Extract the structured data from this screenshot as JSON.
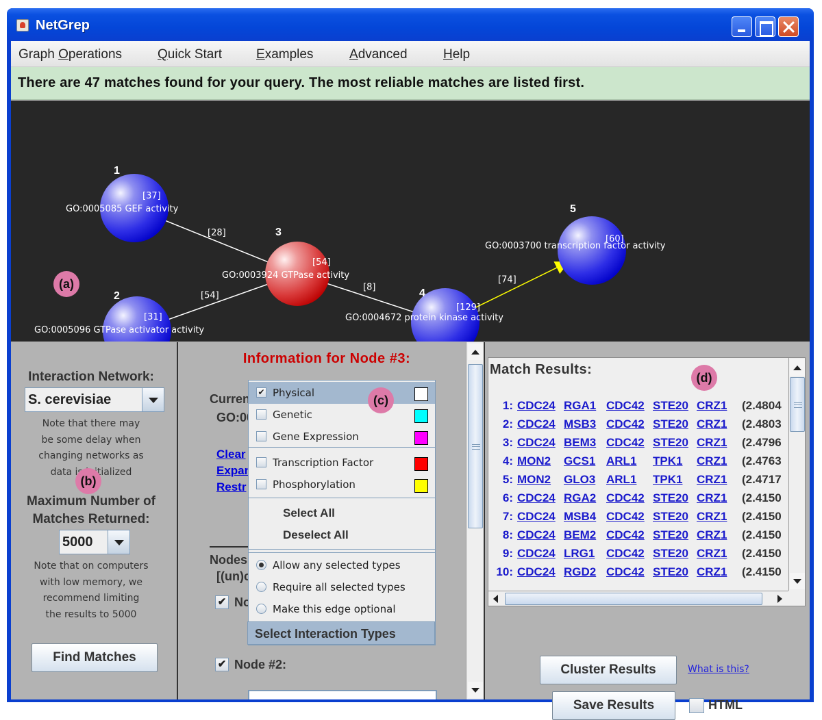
{
  "window": {
    "title": "NetGrep"
  },
  "menu": [
    {
      "pre": "Graph ",
      "mn": "O",
      "post": "perations"
    },
    {
      "pre": "",
      "mn": "Q",
      "post": "uick Start"
    },
    {
      "pre": "",
      "mn": "E",
      "post": "xamples"
    },
    {
      "pre": "",
      "mn": "A",
      "post": "dvanced"
    },
    {
      "pre": "",
      "mn": "H",
      "post": "elp"
    }
  ],
  "status": {
    "text": "There are 47 matches found for your query.  The most reliable matches are listed first."
  },
  "graph": {
    "nodes": [
      {
        "num": "1",
        "count": "[37]",
        "go": "GO:0005085",
        "label": "GEF activity",
        "color": "blue"
      },
      {
        "num": "2",
        "count": "[31]",
        "go": "GO:0005096",
        "label": "GTPase activator activity",
        "color": "blue"
      },
      {
        "num": "3",
        "count": "[54]",
        "go": "GO:0003924",
        "label": "GTPase activity",
        "color": "red"
      },
      {
        "num": "4",
        "count": "[129]",
        "go": "GO:0004672",
        "label": "protein kinase activity",
        "color": "blue"
      },
      {
        "num": "5",
        "count": "[60]",
        "go": "GO:0003700",
        "label": "transcription factor activity",
        "color": "blue"
      }
    ],
    "edges": [
      {
        "from": "1",
        "to": "3",
        "label": "[28]",
        "color": "#ffffff",
        "directed": false
      },
      {
        "from": "2",
        "to": "3",
        "label": "[54]",
        "color": "#ffffff",
        "directed": false
      },
      {
        "from": "3",
        "to": "4",
        "label": "[8]",
        "color": "#ffffff",
        "directed": false
      },
      {
        "from": "4",
        "to": "5",
        "label": "[74]",
        "color": "#ffff00",
        "directed": true
      }
    ]
  },
  "annotations": {
    "a": "(a)",
    "b": "(b)",
    "c": "(c)",
    "d": "(d)"
  },
  "left_panel": {
    "network_label": "Interaction Network:",
    "network_value": "S. cerevisiae",
    "network_note": [
      "Note that there may",
      "be some delay when",
      "changing networks as",
      "data is initialized"
    ],
    "max_label_1": "Maximum Number of",
    "max_label_2": "Matches Returned:",
    "max_value": "5000",
    "max_note": [
      "Note that on computers",
      "with low memory, we",
      "recommend limiting",
      "the results to 5000"
    ],
    "find_button": "Find Matches"
  },
  "node_info": {
    "title": "Information for Node #3:",
    "current_label": "Curren",
    "go_label": "GO:00",
    "links": [
      "Clear",
      "Expan",
      "Restr"
    ],
    "nodes_label": "Nodes",
    "unchecked_label": "[(un)c",
    "node1_label": "No",
    "node1_checked": true,
    "node2_label": "Node #2:",
    "node2_checked": true
  },
  "interaction_popup": {
    "types": [
      {
        "label": "Physical",
        "checked": true,
        "color": "#ffffff",
        "highlighted": true
      },
      {
        "label": "Genetic",
        "checked": false,
        "color": "#00ffff",
        "highlighted": false
      },
      {
        "label": "Gene Expression",
        "checked": false,
        "color": "#ff00ff",
        "highlighted": false
      },
      {
        "label": "Transcription Factor",
        "checked": false,
        "color": "#ff0000",
        "highlighted": false
      },
      {
        "label": "Phosphorylation",
        "checked": false,
        "color": "#ffff00",
        "highlighted": false
      }
    ],
    "select_all": "Select All",
    "deselect_all": "Deselect All",
    "modes": [
      {
        "label": "Allow any selected types",
        "selected": true
      },
      {
        "label": "Require all selected types",
        "selected": false
      },
      {
        "label": "Make this edge optional",
        "selected": false
      }
    ],
    "footer": "Select Interaction Types"
  },
  "results": {
    "title": "Match Results:",
    "rows": [
      {
        "n": "1:",
        "genes": [
          "CDC24",
          "RGA1",
          "CDC42",
          "STE20",
          "CRZ1"
        ],
        "score": "(2.4804"
      },
      {
        "n": "2:",
        "genes": [
          "CDC24",
          "MSB3",
          "CDC42",
          "STE20",
          "CRZ1"
        ],
        "score": "(2.4803"
      },
      {
        "n": "3:",
        "genes": [
          "CDC24",
          "BEM3",
          "CDC42",
          "STE20",
          "CRZ1"
        ],
        "score": "(2.4796"
      },
      {
        "n": "4:",
        "genes": [
          "MON2",
          "GCS1",
          "ARL1",
          "TPK1",
          "CRZ1"
        ],
        "score": "(2.4763"
      },
      {
        "n": "5:",
        "genes": [
          "MON2",
          "GLO3",
          "ARL1",
          "TPK1",
          "CRZ1"
        ],
        "score": "(2.4717"
      },
      {
        "n": "6:",
        "genes": [
          "CDC24",
          "RGA2",
          "CDC42",
          "STE20",
          "CRZ1"
        ],
        "score": "(2.4150"
      },
      {
        "n": "7:",
        "genes": [
          "CDC24",
          "MSB4",
          "CDC42",
          "STE20",
          "CRZ1"
        ],
        "score": "(2.4150"
      },
      {
        "n": "8:",
        "genes": [
          "CDC24",
          "BEM2",
          "CDC42",
          "STE20",
          "CRZ1"
        ],
        "score": "(2.4150"
      },
      {
        "n": "9:",
        "genes": [
          "CDC24",
          "LRG1",
          "CDC42",
          "STE20",
          "CRZ1"
        ],
        "score": "(2.4150"
      },
      {
        "n": "10:",
        "genes": [
          "CDC24",
          "RGD2",
          "CDC42",
          "STE20",
          "CRZ1"
        ],
        "score": "(2.4150"
      }
    ],
    "cluster_button": "Cluster Results",
    "what_link": "What is this?",
    "save_button": "Save Results",
    "html_label": "HTML",
    "html_checked": false
  }
}
